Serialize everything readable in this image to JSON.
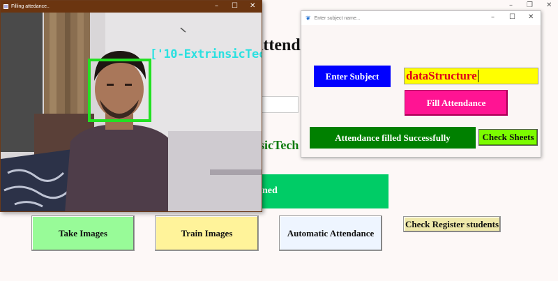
{
  "background": {
    "title_fragment": "Attend",
    "org_fragment": "sicTech",
    "green_bar_fragment": "ned",
    "buttons": {
      "take_images": "Take Images",
      "train_images": "Train Images",
      "automatic_attendance": "Automatic Attendance",
      "check_register": "Check Register students"
    },
    "window_controls": [
      "–",
      "❐",
      "✕"
    ]
  },
  "camera_window": {
    "title": "Filling attedance..",
    "overlay_label": "['10-ExtrinsicTec",
    "window_controls": [
      "–",
      "☐",
      "✕"
    ]
  },
  "subject_dialog": {
    "title": "Enter subject name...",
    "enter_subject_label": "Enter Subject",
    "subject_value": "dataStructure",
    "fill_attendance_label": "Fill Attendance",
    "status_message": "Attendance filled Successfully",
    "check_sheets_label": "Check Sheets",
    "window_controls": [
      "–",
      "☐",
      "✕"
    ]
  },
  "colors": {
    "enter_subject_bg": "#0000ff",
    "input_bg": "#ffff00",
    "input_text": "#e0001a",
    "fill_attendance_bg": "#ff1493",
    "status_bg": "#008000",
    "check_sheets_bg": "#7cfc00",
    "take_images_bg": "#98fb98",
    "train_images_bg": "#fff39a",
    "register_bg": "#eee8aa",
    "face_box": "#22e022",
    "overlay_label": "#2be0e0"
  }
}
